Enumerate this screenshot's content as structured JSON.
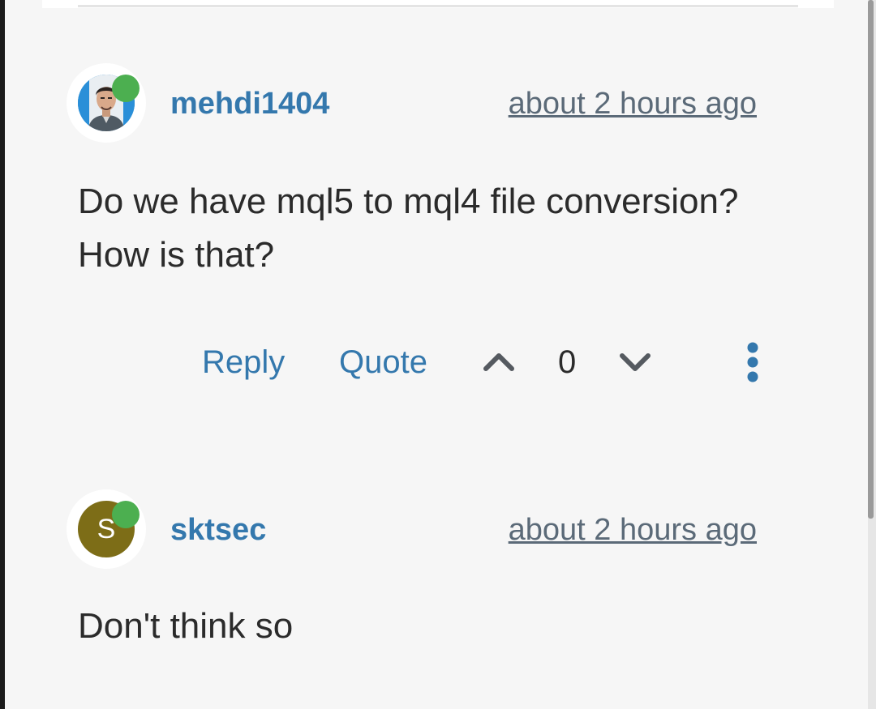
{
  "posts": [
    {
      "username": "mehdi1404",
      "timestamp": "about 2 hours ago",
      "body": "Do we have mql5 to mql4 file conversion? How is that?",
      "avatar_type": "photo",
      "online": true,
      "actions": {
        "reply_label": "Reply",
        "quote_label": "Quote",
        "vote_count": "0",
        "upvote_icon": "chevron-up-icon",
        "downvote_icon": "chevron-down-icon",
        "more_icon": "more-vertical-icon"
      }
    },
    {
      "username": "sktsec",
      "timestamp": "about 2 hours ago",
      "body": "Don't think so",
      "avatar_type": "letter",
      "avatar_letter": "S",
      "online": true
    }
  ],
  "colors": {
    "link_blue": "#3478ad",
    "online_green": "#4caf50",
    "avatar_olive": "#7d6d17",
    "background": "#f6f6f6"
  }
}
